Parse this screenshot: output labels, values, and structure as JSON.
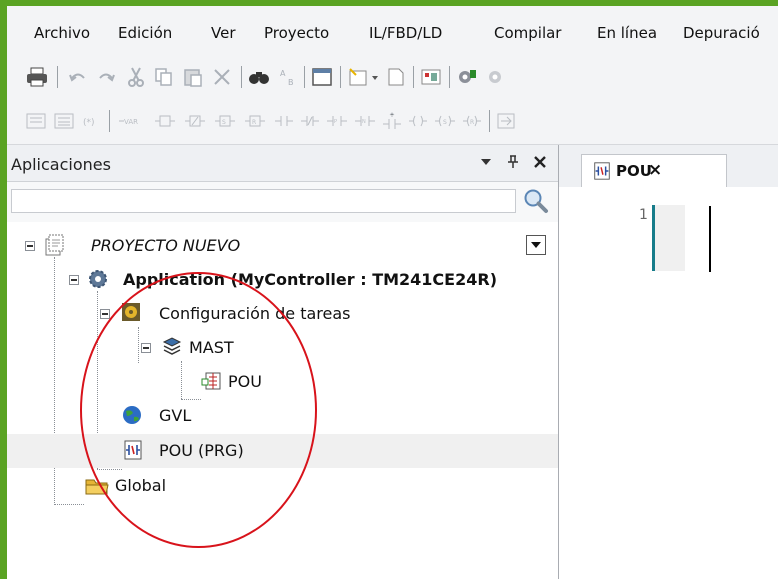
{
  "menu": {
    "items": [
      {
        "label": "Archivo"
      },
      {
        "label": "Edición"
      },
      {
        "label": "Ver"
      },
      {
        "label": "Proyecto"
      },
      {
        "label": "IL/FBD/LD"
      },
      {
        "label": "Compilar"
      },
      {
        "label": "En línea"
      },
      {
        "label": "Depuració"
      }
    ]
  },
  "panel": {
    "title": "Aplicaciones",
    "search_placeholder": ""
  },
  "tree": {
    "project": "PROYECTO NUEVO",
    "application": "Application (MyController : TM241CE24R)",
    "task_config": "Configuración de tareas",
    "mast": "MAST",
    "mast_pou": "POU",
    "gvl": "GVL",
    "pou_prg": "POU (PRG)",
    "global": "Global"
  },
  "editor": {
    "tab_label": "POU",
    "tab_close": "×",
    "line_number": "1"
  },
  "colors": {
    "frame_green": "#5aa323",
    "annotation_red": "#d8131b",
    "gutter_teal": "#177c8a"
  }
}
